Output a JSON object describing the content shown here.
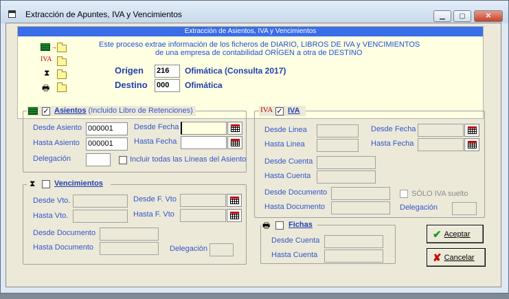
{
  "window": {
    "title": "Extracción de Apuntes, IVA y Vencimientos"
  },
  "banner": {
    "header": "Extracción de Asientos, IVA y Vencimientos",
    "description_line1": "Este proceso extrae información de los ficheros de DIARIO, LIBROS DE IVA y VENCIMIENTOS",
    "description_line2": "de una empresa de  contabilidad ORÍGEN a otra de DESTINO",
    "origen_label": "Orígen",
    "origen_code": "216",
    "origen_name": "Ofimática (Consulta 2017)",
    "destino_label": "Destino",
    "destino_code": "000",
    "destino_name": "Ofimática"
  },
  "asientos": {
    "title": "Asientos",
    "subtitle": "(Incluido Libro de Retenciones)",
    "checked_mark": "✓",
    "desde_asiento_label": "Desde Asiento",
    "desde_asiento_value": "000001",
    "hasta_asiento_label": "Hasta Asiento",
    "hasta_asiento_value": "000001",
    "desde_fecha_label": "Desde Fecha",
    "desde_fecha_value": "",
    "hasta_fecha_label": "Hasta Fecha",
    "hasta_fecha_value": "",
    "delegacion_label": "Delegación",
    "delegacion_value": "",
    "incluir_label": "Incluir todas las Líneas del Asiento"
  },
  "vencimientos": {
    "title": "Vencimientos",
    "desde_vto_label": "Desde Vto.",
    "hasta_vto_label": "Hasta Vto.",
    "desde_fvto_label": "Desde F. Vto",
    "hasta_fvto_label": "Hasta F. Vto",
    "desde_documento_label": "Desde Documento",
    "hasta_documento_label": "Hasta Documento",
    "delegacion_label": "Delegación"
  },
  "iva": {
    "icon_text": "IVA",
    "title": "IVA",
    "checked_mark": "✓",
    "desde_linea_label": "Desde Linea",
    "hasta_linea_label": "Hasta Linea",
    "desde_fecha_label": "Desde Fecha",
    "hasta_fecha_label": "Hasta Fecha",
    "desde_cuenta_label": "Desde Cuenta",
    "hasta_cuenta_label": "Hasta Cuenta",
    "desde_documento_label": "Desde Documento",
    "hasta_documento_label": "Hasta Documento",
    "solo_iva_label": "SÓLO IVA suelto",
    "delegacion_label": "Delegación"
  },
  "fichas": {
    "title": "Fichas",
    "desde_cuenta_label": "Desde Cuenta",
    "hasta_cuenta_label": "Hasta Cuenta"
  },
  "buttons": {
    "aceptar": "Aceptar",
    "cancelar": "Cancelar",
    "check_glyph": "✔",
    "cross_glyph": "✘"
  },
  "colors": {
    "banner_header": "#3a6ee8",
    "banner_bg": "#ffffe1",
    "label_blue": "#3355cc",
    "iva_red": "#c00000",
    "aceptar_icon": "#1a9a1a",
    "cancelar_icon": "#cc0000"
  },
  "icons": [
    "app-icon",
    "minimize-icon",
    "maximize-icon",
    "close-icon",
    "ledger-icon",
    "folder-icon",
    "iva-icon",
    "hourglass-icon",
    "printer-icon",
    "calendar-icon"
  ]
}
